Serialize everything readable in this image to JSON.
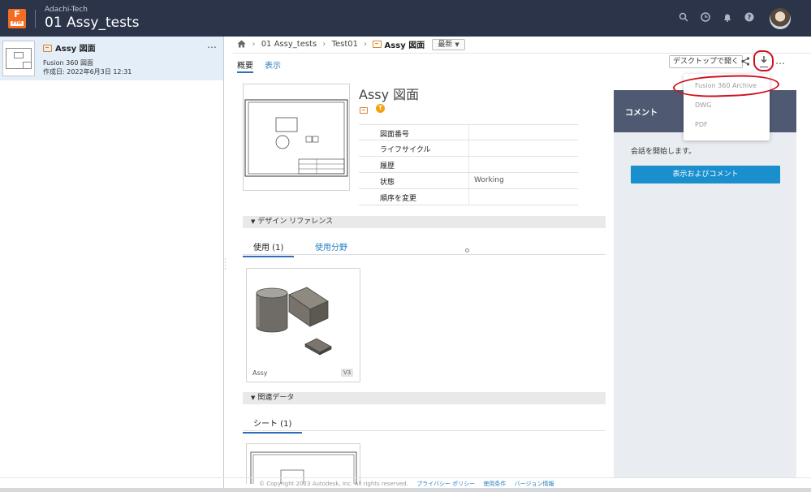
{
  "header": {
    "logo_letter": "F",
    "logo_sub": "FTM",
    "team": "Adachi-Tech",
    "project": "01 Assy_tests"
  },
  "left": {
    "file_name": "Assy 図面",
    "file_type": "Fusion 360 図面",
    "created": "作成日:  2022年6月3日 12:31",
    "more": "…"
  },
  "breadcrumb": {
    "project": "01 Assy_tests",
    "folder": "Test01",
    "current": "Assy 図面",
    "version": "最新"
  },
  "tabs": {
    "overview": "概要",
    "view": "表示"
  },
  "toolbar": {
    "open_desktop": "デスクトップで開く",
    "more": "…"
  },
  "download_menu": {
    "items": [
      "Fusion 360 Archive",
      "DWG",
      "PDF"
    ]
  },
  "doc": {
    "title": "Assy 図面",
    "badge": "T"
  },
  "props": [
    {
      "k": "図面番号",
      "v": ""
    },
    {
      "k": "ライフサイクル",
      "v": ""
    },
    {
      "k": "履歴",
      "v": ""
    },
    {
      "k": "状態",
      "v": "Working"
    },
    {
      "k": "順序を変更",
      "v": ""
    }
  ],
  "design_refs": {
    "section": "デザイン リファレンス",
    "tab_uses": "使用 (1)",
    "tab_used_in": "使用分野",
    "card_name": "Assy",
    "card_version": "V3"
  },
  "related": {
    "section": "関連データ",
    "tab_sheets": "シート (1)"
  },
  "comments": {
    "title": "コメント",
    "empty": "会話を開始します。",
    "button": "表示およびコメント"
  },
  "footer": {
    "copyright": "© Copyright 2023 Autodesk, Inc. All rights reserved.",
    "privacy": "プライバシー ポリシー",
    "terms": "使用条件",
    "version": "バージョン情報"
  },
  "colors": {
    "topbar": "#2b3449",
    "accent": "#1a8fce",
    "annotation": "#d0101e"
  }
}
